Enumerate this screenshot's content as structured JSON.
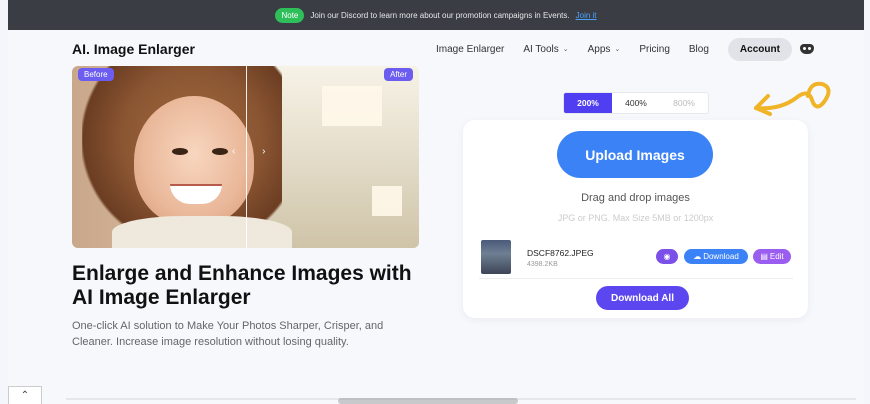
{
  "banner": {
    "badge": "Note",
    "message": "Join our Discord to learn more about our promotion campaigns in Events.",
    "link": "Join it"
  },
  "header": {
    "logo": "AI. Image Enlarger",
    "nav": [
      {
        "label": "Image Enlarger",
        "dropdown": false
      },
      {
        "label": "AI Tools",
        "dropdown": true
      },
      {
        "label": "Apps",
        "dropdown": true
      },
      {
        "label": "Pricing",
        "dropdown": false
      },
      {
        "label": "Blog",
        "dropdown": false
      }
    ],
    "account": "Account",
    "discord_icon": "discord-icon"
  },
  "hero": {
    "tag_before": "Before",
    "tag_after": "After",
    "headline": "Enlarge and Enhance Images with AI Image Enlarger",
    "subtext": "One-click AI solution to Make Your Photos Sharper, Crisper, and Cleaner. Increase image resolution without losing quality."
  },
  "scale": {
    "options": [
      "200%",
      "400%",
      "800%"
    ],
    "selected": "200%"
  },
  "upload": {
    "button": "Upload Images",
    "drag": "Drag and drop images",
    "limit": "JPG or PNG. Max Size 5MB or 1200px",
    "file": {
      "name": "DSCF8762.JPEG",
      "size": "4398.2KB"
    },
    "download": "Download",
    "edit": "Edit",
    "download_all": "Download All"
  },
  "colors": {
    "accent": "#4f3ff0",
    "upload_blue": "#3b82f6",
    "doodle": "#f0b429"
  }
}
